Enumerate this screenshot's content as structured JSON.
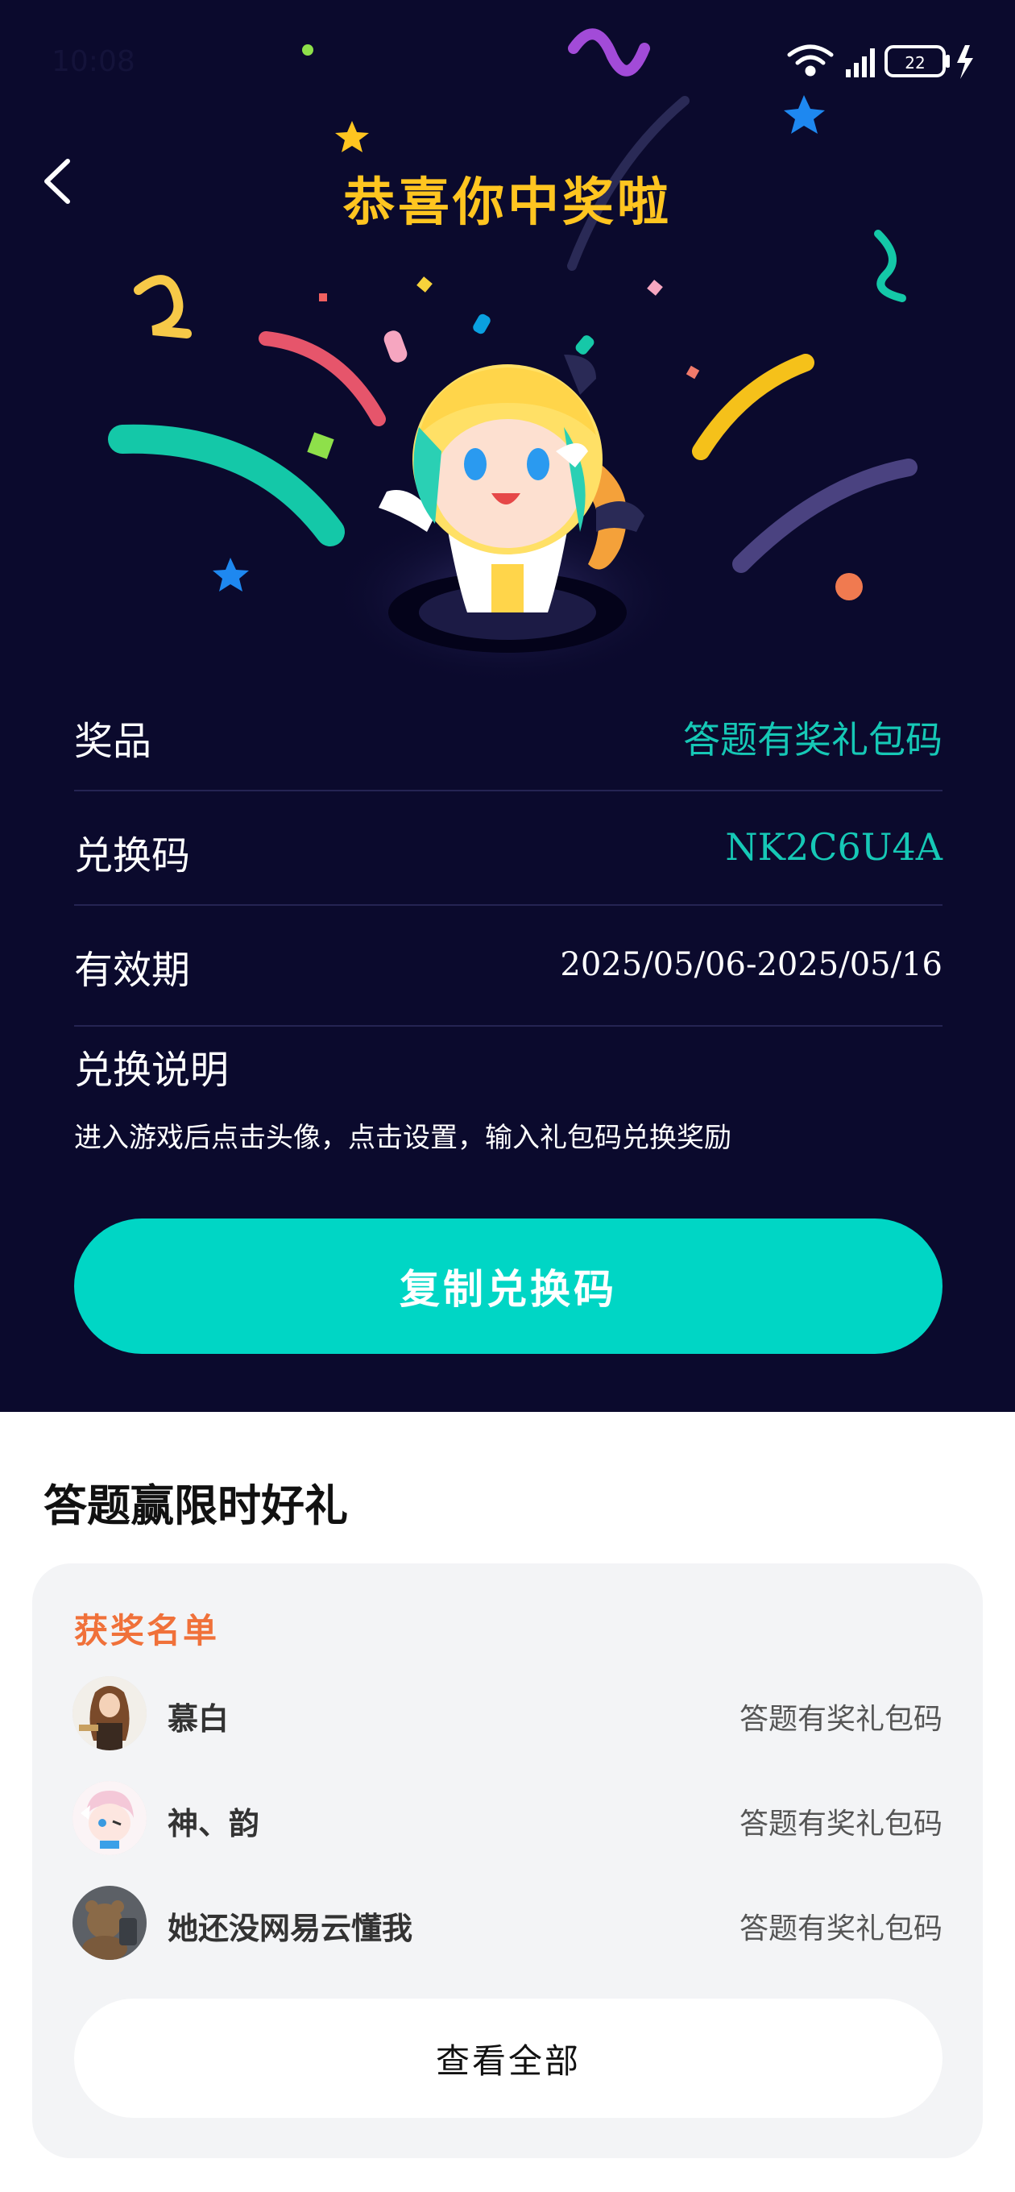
{
  "status": {
    "time": "10:08",
    "battery": "22"
  },
  "header": {
    "title": "恭喜你中奖啦"
  },
  "prize": {
    "prize_label": "奖品",
    "prize_value": "答题有奖礼包码",
    "code_label": "兑换码",
    "code_value": "NK2C6U4A",
    "validity_label": "有效期",
    "validity_value": "2025/05/06-2025/05/16",
    "instructions_label": "兑换说明",
    "instructions_text": "进入游戏后点击头像，点击设置，输入礼包码兑换奖励"
  },
  "copy_button": "复制兑换码",
  "lower": {
    "title": "答题赢限时好礼",
    "card_title": "获奖名单",
    "winners": [
      {
        "name": "慕白",
        "prize": "答题有奖礼包码"
      },
      {
        "name": "神、韵",
        "prize": "答题有奖礼包码"
      },
      {
        "name": "她还没网易云懂我",
        "prize": "答题有奖礼包码"
      }
    ],
    "view_all": "查看全部"
  },
  "colors": {
    "background": "#0b0a2d",
    "title": "#ffc520",
    "accent": "#00d6c5",
    "highlight": "#16c8b6",
    "card_title": "#f0713a"
  }
}
